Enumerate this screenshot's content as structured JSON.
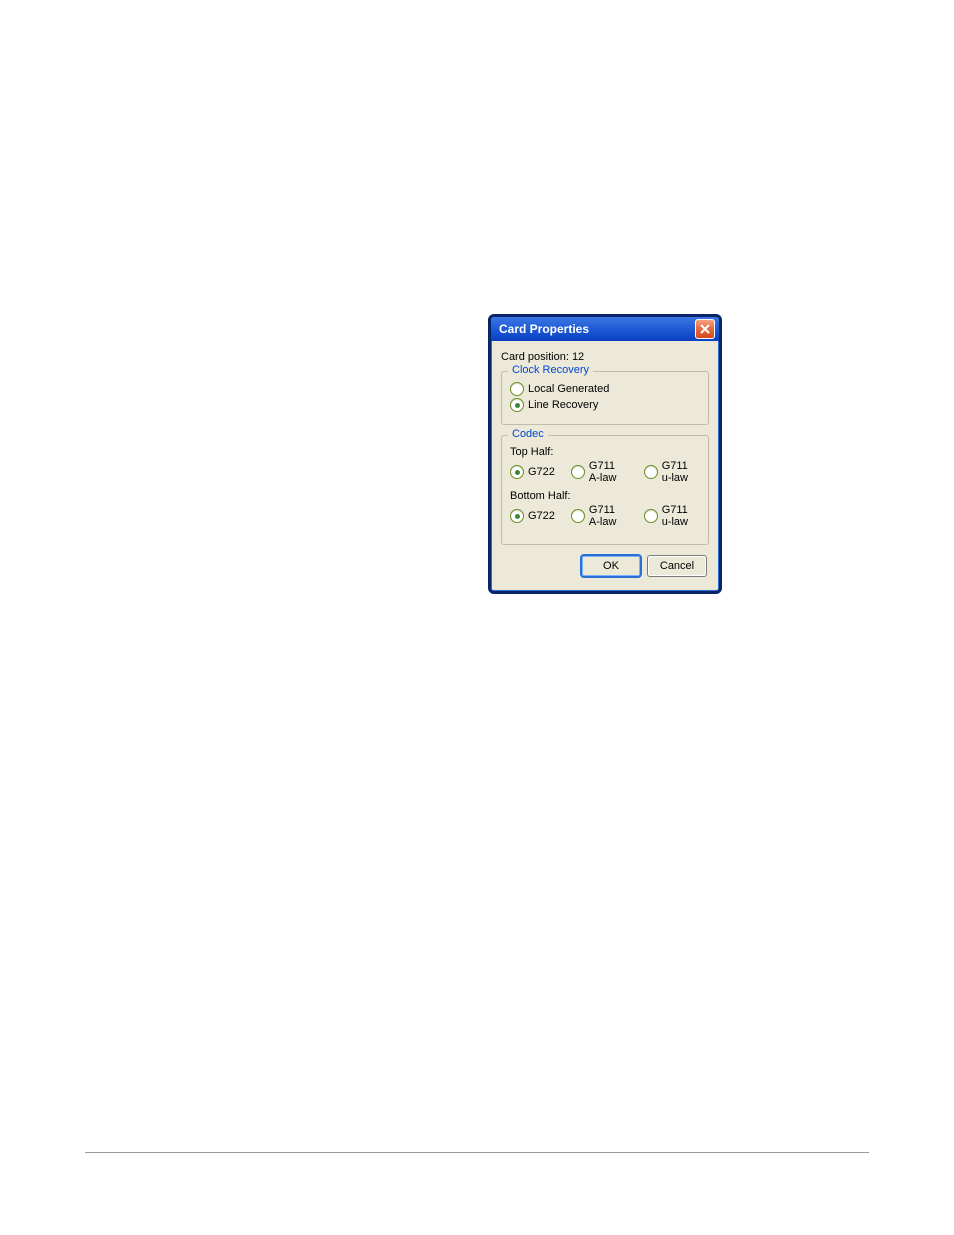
{
  "dialog": {
    "title": "Card Properties",
    "card_position_label": "Card position:",
    "card_position_value": "12",
    "clock_recovery": {
      "legend": "Clock Recovery",
      "options": [
        {
          "label": "Local Generated",
          "checked": false
        },
        {
          "label": "Line Recovery",
          "checked": true
        }
      ]
    },
    "codec": {
      "legend": "Codec",
      "top_half_label": "Top Half:",
      "top_half_options": [
        {
          "label": "G722",
          "checked": true
        },
        {
          "label": "G711 A-law",
          "checked": false
        },
        {
          "label": "G711 u-law",
          "checked": false
        }
      ],
      "bottom_half_label": "Bottom Half:",
      "bottom_half_options": [
        {
          "label": "G722",
          "checked": true
        },
        {
          "label": "G711 A-law",
          "checked": false
        },
        {
          "label": "G711 u-law",
          "checked": false
        }
      ]
    },
    "buttons": {
      "ok": "OK",
      "cancel": "Cancel"
    }
  }
}
